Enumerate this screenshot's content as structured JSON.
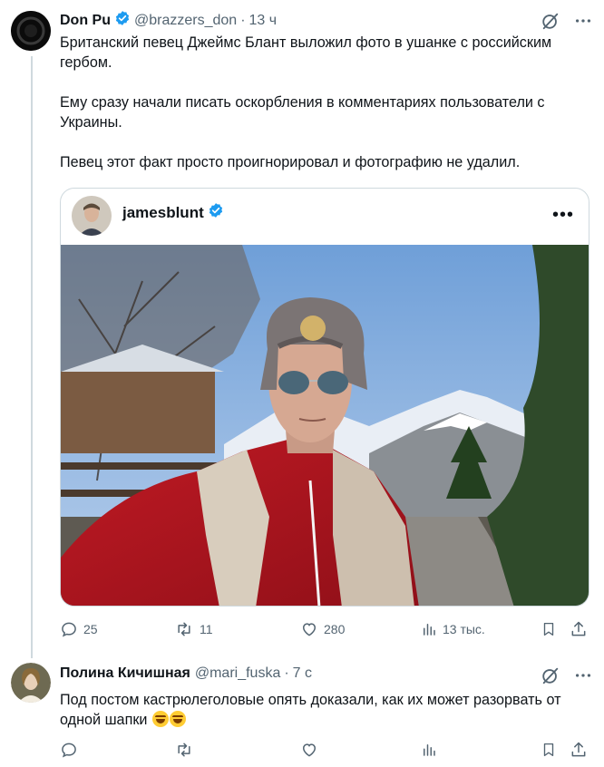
{
  "tweet": {
    "author_name": "Don Pu",
    "author_handle": "@brazzers_don",
    "separator": "·",
    "time": "13 ч",
    "paragraphs": [
      "Британский певец Джеймс Блант выложил фото в ушанке с российским гербом.",
      "Ему сразу начали писать оскорбления в комментариях пользователи с Украины.",
      "Певец этот факт просто проигнорировал и фотографию не удалил."
    ],
    "embed": {
      "username": "jamesblunt",
      "more": "•••"
    },
    "actions": {
      "replies": "25",
      "retweets": "11",
      "likes": "280",
      "views": "13 тыс."
    }
  },
  "reply": {
    "author_name": "Полина Кичишная",
    "author_handle": "@mari_fuska",
    "separator": "·",
    "time": "7 с",
    "text": "Под постом кастрюлеголовые опять доказали, как их может разорвать от одной шапки",
    "actions": {
      "replies": "",
      "retweets": "",
      "likes": "",
      "views": ""
    }
  },
  "colors": {
    "verified": "#1d9bf0",
    "muted": "#536471",
    "text": "#0f1419",
    "border": "#cfd9de"
  },
  "icons": {
    "verified": "verified-badge-icon",
    "grok": "grok-icon",
    "more": "more-icon",
    "reply": "reply-icon",
    "retweet": "retweet-icon",
    "like": "heart-icon",
    "views": "views-icon",
    "bookmark": "bookmark-icon",
    "share": "share-icon"
  }
}
